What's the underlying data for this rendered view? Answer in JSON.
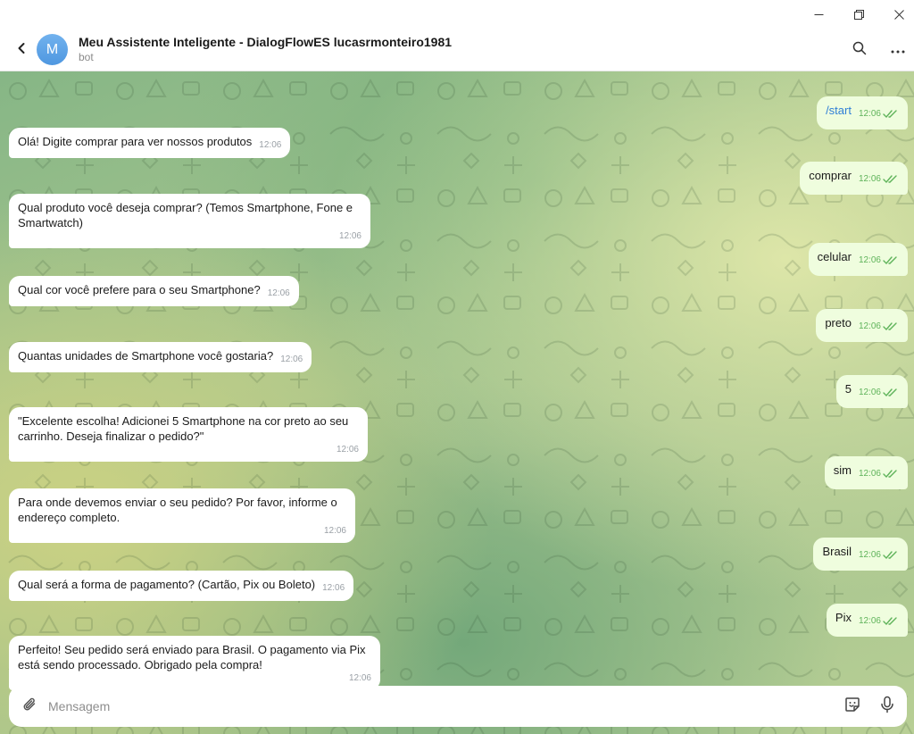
{
  "window": {
    "controls": {
      "minimize_icon": "minimize-icon",
      "restore_icon": "restore-icon",
      "close_icon": "close-icon"
    }
  },
  "header": {
    "avatar_letter": "M",
    "title": "Meu Assistente Inteligente - DialogFlowES lucasrmonteiro1981",
    "status": "bot",
    "accent_color": "#5a9fe6"
  },
  "messages": [
    {
      "dir": "out",
      "text": "/start",
      "time": "12:06"
    },
    {
      "dir": "in",
      "text": "Olá! Digite comprar para ver nossos produtos",
      "time": "12:06"
    },
    {
      "dir": "out",
      "text": "comprar",
      "time": "12:06"
    },
    {
      "dir": "in",
      "text": "Qual produto você deseja comprar? (Temos Smartphone, Fone e Smartwatch)",
      "time": "12:06"
    },
    {
      "dir": "out",
      "text": "celular",
      "time": "12:06"
    },
    {
      "dir": "in",
      "text": "Qual cor você prefere para o seu Smartphone?",
      "time": "12:06"
    },
    {
      "dir": "out",
      "text": "preto",
      "time": "12:06"
    },
    {
      "dir": "in",
      "text": "Quantas unidades de Smartphone você gostaria?",
      "time": "12:06"
    },
    {
      "dir": "out",
      "text": "5",
      "time": "12:06"
    },
    {
      "dir": "in",
      "text": "\"Excelente escolha! Adicionei 5 Smartphone na cor preto ao seu carrinho. Deseja finalizar o pedido?\"",
      "time": "12:06"
    },
    {
      "dir": "out",
      "text": "sim",
      "time": "12:06"
    },
    {
      "dir": "in",
      "text": "Para onde devemos enviar o seu pedido? Por favor, informe o endereço completo.",
      "time": "12:06"
    },
    {
      "dir": "out",
      "text": "Brasil",
      "time": "12:06"
    },
    {
      "dir": "in",
      "text": "Qual será a forma de pagamento? (Cartão, Pix ou Boleto)",
      "time": "12:06"
    },
    {
      "dir": "out",
      "text": "Pix",
      "time": "12:06"
    },
    {
      "dir": "in",
      "text": "Perfeito! Seu pedido será enviado para Brasil. O pagamento via Pix está sendo processado. Obrigado pela compra!",
      "time": "12:06"
    }
  ],
  "composer": {
    "placeholder": "Mensagem",
    "value": ""
  },
  "colors": {
    "incoming_bubble": "#ffffff",
    "outgoing_bubble": "#effdde",
    "read_check": "#5fb35a",
    "command_link": "#2f7fd6"
  }
}
